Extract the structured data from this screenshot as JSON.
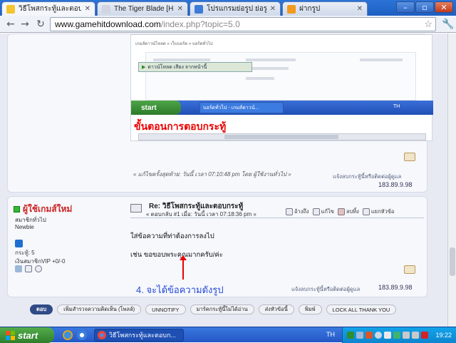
{
  "browser": {
    "tabs": [
      {
        "title": "วิธีโพสกระทู้และตอบกร...",
        "active": true,
        "favicon_color": "#f3c530"
      },
      {
        "title": "The Tiger Blade [HD]",
        "active": false,
        "favicon_color": "#cfd4e0"
      },
      {
        "title": "โปรแกรมย่อรูป ย่อรูปใ",
        "active": false,
        "favicon_color": "#3d7bd8"
      },
      {
        "title": "ฝากรูป",
        "active": false,
        "favicon_color": "#f29a1e"
      }
    ],
    "window_controls": {
      "minimize": "–",
      "maximize": "▫",
      "close": "✕"
    },
    "back_icon": "←",
    "forward_icon": "→",
    "reload_icon": "↻",
    "url_host": "www.gamehitdownload.com",
    "url_path": "/index.php?topic=5.0",
    "star_icon": "☆",
    "wrench_icon": "🔧"
  },
  "post1": {
    "screenshot": {
      "breadcrumb": "เกมส์ดาวน์โหลด » เว็บบอร์ด » บอร์ดทั่วไป",
      "download_bar": "ดาวน์โหลด เสียง จากหน้านี้",
      "start": "start",
      "task_item": "บอร์ดทั่วไป - เกมส์ดาวน์...",
      "tray_lang": "TH",
      "caption": "ขั้นตอนการตอบกระทู้"
    },
    "edit_note": "« แก้ไขครั้งสุดท้าย: วันนี้ เวลา 07:10:48 pm โดย ผู้ใช้งานทั่วไป »",
    "report_text": "แจ้งลบกระทู้นี้หรือติดต่อผู้ดูแล",
    "ip": "183.89.9.98"
  },
  "post2": {
    "username": "ผู้ใช้เกมส์ใหม่",
    "rank": "สมาชิกทั่วไป",
    "group": "Newbie",
    "posts": "กระทู้: 5",
    "karma": "เงินสมาชิกVIP +0/-0",
    "subject": "Re: วิธีโพสกระทู้และตอบกระทู้",
    "meta": "« ตอบกลับ #1 เมื่อ: วันนี้ เวลา 07:18:36 pm »",
    "actions": [
      "อ้างถึง",
      "แก้ไข",
      "ลบทิ้ง",
      "แยกหัวข้อ"
    ],
    "body_line1": "ใส่ข้อความที่ท่าต้องการลงไป",
    "body_line2": "เช่น  ขอขอบพระคุณมากครับ/ค่ะ",
    "annotation": "4. จะได้ข้อความดังรูป",
    "report_text": "แจ้งลบกระทู้นี้หรือติดต่อผู้ดูแล",
    "ip": "183.89.9.98"
  },
  "bottom_buttons": [
    "ตอบ",
    "เพิ่มสำรวจความคิดเห็น (โพลล์)",
    "UNNOTIFY",
    "มาร์คกระทู้นี้ไม่ได้อ่าน",
    "ส่งหัวข้อนี้",
    "พิมพ์",
    "LOCK ALL THANK YOU"
  ],
  "taskbar": {
    "start": "start",
    "task_item": "วิธีโพสกระทู้และตอบก...",
    "lang": "TH",
    "clock": "19:22"
  }
}
